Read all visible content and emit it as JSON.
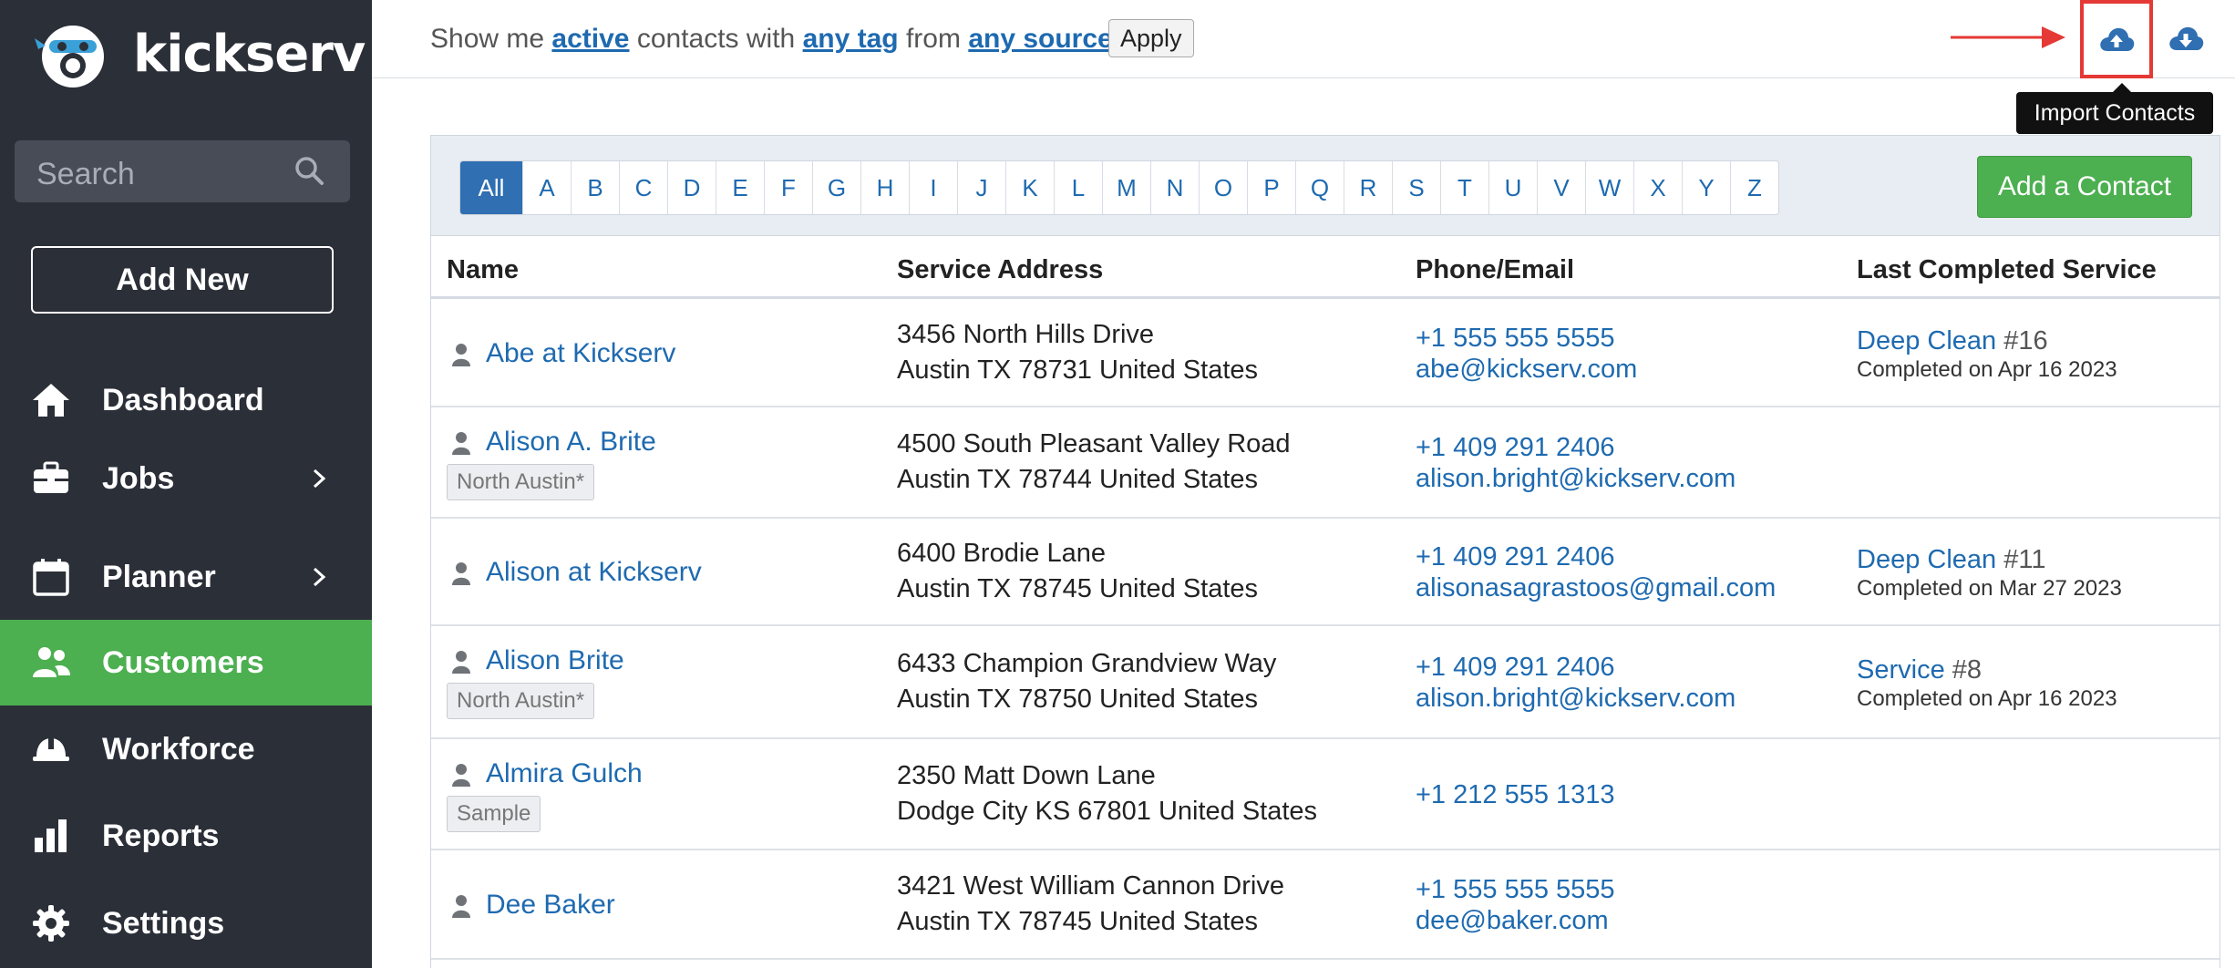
{
  "app": {
    "brand": "kickserv",
    "accent_color": "#4caf50",
    "sidebar_color": "#2b2f38",
    "link_color": "#1e6ab0"
  },
  "sidebar": {
    "search_placeholder": "Search",
    "add_new_label": "Add New",
    "items": [
      {
        "label": "Dashboard",
        "icon": "home-icon",
        "has_chevron": false,
        "active": false
      },
      {
        "label": "Jobs",
        "icon": "briefcase-icon",
        "has_chevron": true,
        "active": false
      },
      {
        "label": "Planner",
        "icon": "calendar-icon",
        "has_chevron": true,
        "active": false
      },
      {
        "label": "Customers",
        "icon": "users-icon",
        "has_chevron": false,
        "active": true
      },
      {
        "label": "Workforce",
        "icon": "hard-hat-icon",
        "has_chevron": false,
        "active": false
      },
      {
        "label": "Reports",
        "icon": "bar-chart-icon",
        "has_chevron": false,
        "active": false
      },
      {
        "label": "Settings",
        "icon": "gear-icon",
        "has_chevron": false,
        "active": false
      }
    ]
  },
  "filter": {
    "prefix": "Show me",
    "status": "active",
    "middle1": "contacts with",
    "tag": "any tag",
    "middle2": "from",
    "source": "any source",
    "apply_label": "Apply"
  },
  "toolbar": {
    "import_tooltip": "Import Contacts",
    "import_icon": "cloud-upload-icon",
    "export_icon": "cloud-download-icon",
    "highlight_color": "#e53935"
  },
  "alphabet": [
    "All",
    "A",
    "B",
    "C",
    "D",
    "E",
    "F",
    "G",
    "H",
    "I",
    "J",
    "K",
    "L",
    "M",
    "N",
    "O",
    "P",
    "Q",
    "R",
    "S",
    "T",
    "U",
    "V",
    "W",
    "X",
    "Y",
    "Z"
  ],
  "add_contact_label": "Add a Contact",
  "columns": {
    "name": "Name",
    "address": "Service Address",
    "contact": "Phone/Email",
    "service": "Last Completed Service"
  },
  "rows": [
    {
      "name": "Abe at Kickserv",
      "tag": "",
      "addr1": "3456 North Hills Drive",
      "addr2": "Austin TX 78731 United States",
      "phone": "+1 555 555 5555",
      "email": "abe@kickserv.com",
      "service": "Deep Clean",
      "service_no": "#16",
      "completed": "Completed on Apr 16 2023"
    },
    {
      "name": "Alison A. Brite",
      "tag": "North Austin*",
      "addr1": "4500 South Pleasant Valley Road",
      "addr2": "Austin TX 78744 United States",
      "phone": "+1 409 291 2406",
      "email": "alison.bright@kickserv.com",
      "service": "",
      "service_no": "",
      "completed": ""
    },
    {
      "name": "Alison at Kickserv",
      "tag": "",
      "addr1": "6400 Brodie Lane",
      "addr2": "Austin TX 78745 United States",
      "phone": "+1 409 291 2406",
      "email": "alisonasagrastoos@gmail.com",
      "service": "Deep Clean",
      "service_no": "#11",
      "completed": "Completed on Mar 27 2023"
    },
    {
      "name": "Alison Brite",
      "tag": "North Austin*",
      "addr1": "6433 Champion Grandview Way",
      "addr2": "Austin TX 78750 United States",
      "phone": "+1 409 291 2406",
      "email": "alison.bright@kickserv.com",
      "service": "Service",
      "service_no": "#8",
      "completed": "Completed on Apr 16 2023"
    },
    {
      "name": "Almira Gulch",
      "tag": "Sample",
      "addr1": "2350 Matt Down Lane",
      "addr2": "Dodge City KS 67801 United States",
      "phone": "+1 212 555 1313",
      "email": "",
      "service": "",
      "service_no": "",
      "completed": ""
    },
    {
      "name": "Dee Baker",
      "tag": "",
      "addr1": "3421 West William Cannon Drive",
      "addr2": "Austin TX 78745 United States",
      "phone": "+1 555 555 5555",
      "email": "dee@baker.com",
      "service": "",
      "service_no": "",
      "completed": ""
    }
  ]
}
